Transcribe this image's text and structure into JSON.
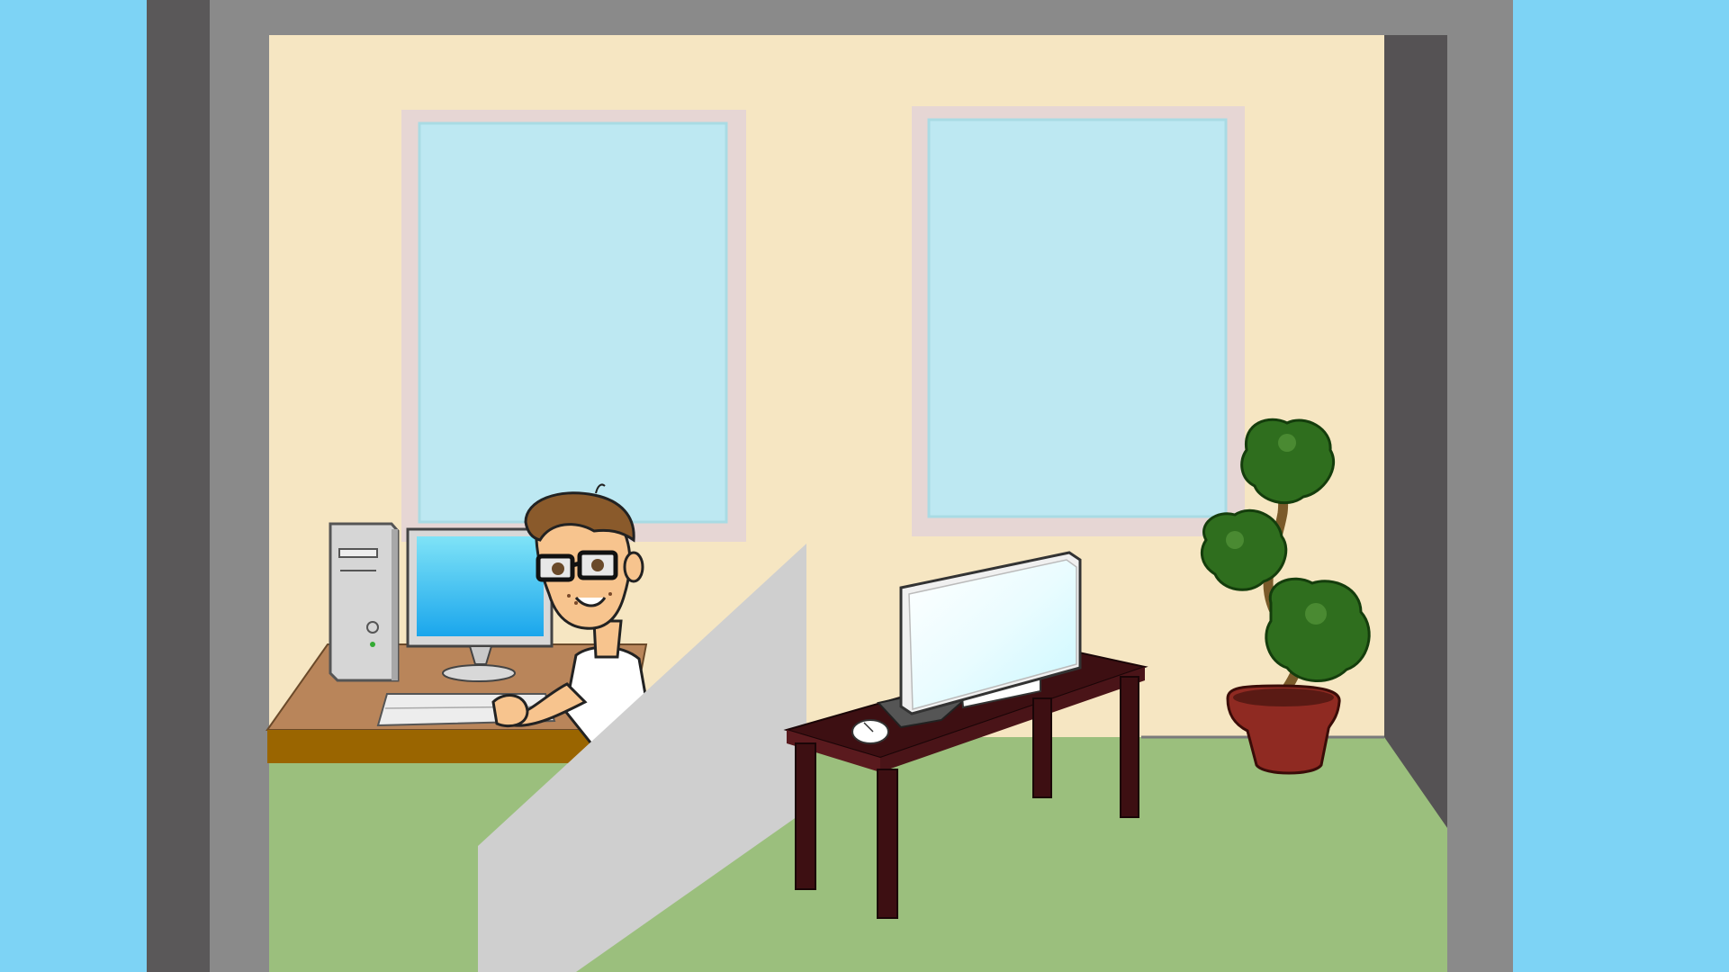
{
  "scene": {
    "colors": {
      "sky": "#7dd3f5",
      "frame_outer": "#5a5859",
      "frame_mid": "#8a8a8a",
      "wall": "#f6e6c2",
      "floor": "#9bbf7d",
      "window_frame": "#e6d6d4",
      "window_glass": "#bde8f2",
      "partition": "#cfcfcf",
      "desk_top": "#b9855a",
      "desk_edge": "#9a6500",
      "dark_table": "#3d0f12",
      "plant_green": "#2f6e1e",
      "pot": "#8f2a22"
    },
    "icons": {
      "person": "cartoon-office-worker",
      "plant": "bonsai-tree",
      "computer_left": "desktop-pc-tower-and-monitor",
      "computer_right": "all-in-one-monitor"
    }
  }
}
